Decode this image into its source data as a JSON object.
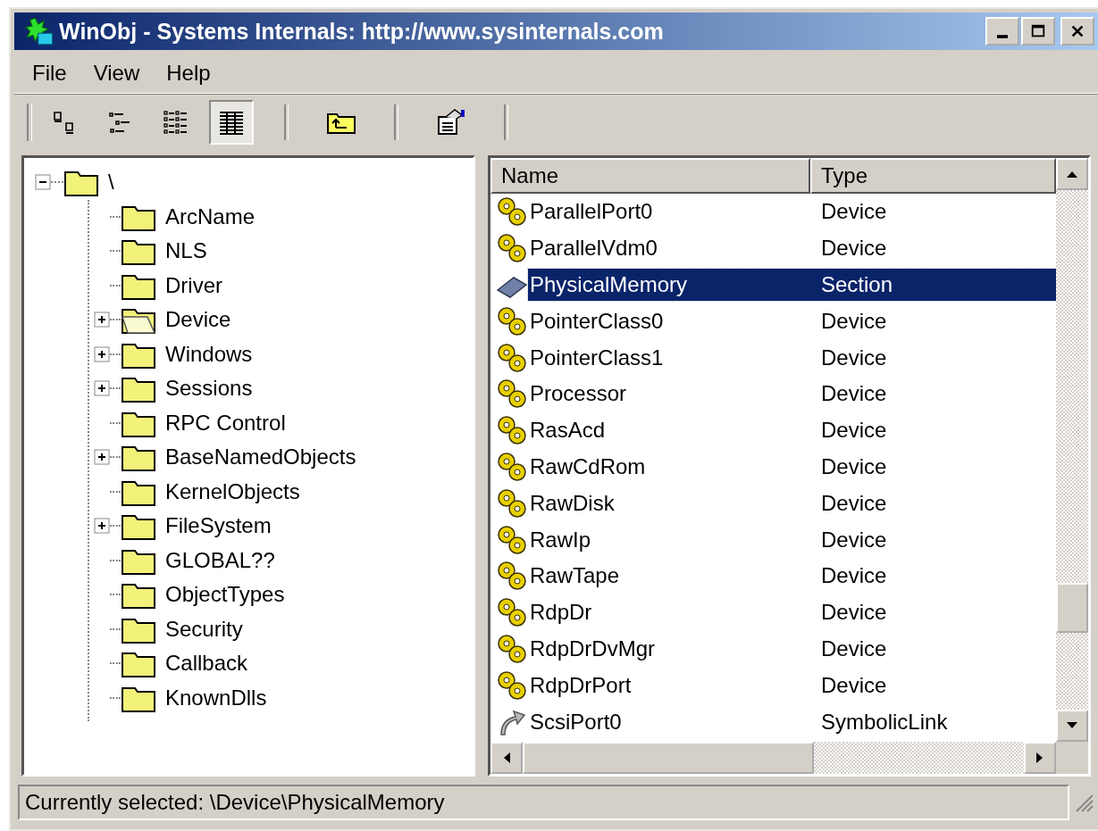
{
  "window": {
    "title": "WinObj - Systems Internals: http://www.sysinternals.com"
  },
  "menu": [
    {
      "label": "File"
    },
    {
      "label": "View"
    },
    {
      "label": "Help"
    }
  ],
  "toolbar": {
    "view_buttons": [
      {
        "kind": "large",
        "selected": false
      },
      {
        "kind": "small",
        "selected": false
      },
      {
        "kind": "list",
        "selected": false
      },
      {
        "kind": "details",
        "selected": true
      }
    ]
  },
  "tree": {
    "label": "\\",
    "expanded": true,
    "children": [
      {
        "label": "ArcName",
        "expander": false,
        "selected": false
      },
      {
        "label": "NLS",
        "expander": false,
        "selected": false
      },
      {
        "label": "Driver",
        "expander": false,
        "selected": false
      },
      {
        "label": "Device",
        "expander": true,
        "selected": true
      },
      {
        "label": "Windows",
        "expander": true,
        "selected": false
      },
      {
        "label": "Sessions",
        "expander": true,
        "selected": false
      },
      {
        "label": "RPC Control",
        "expander": false,
        "selected": false
      },
      {
        "label": "BaseNamedObjects",
        "expander": true,
        "selected": false
      },
      {
        "label": "KernelObjects",
        "expander": false,
        "selected": false
      },
      {
        "label": "FileSystem",
        "expander": true,
        "selected": false
      },
      {
        "label": "GLOBAL??",
        "expander": false,
        "selected": false
      },
      {
        "label": "ObjectTypes",
        "expander": false,
        "selected": false
      },
      {
        "label": "Security",
        "expander": false,
        "selected": false
      },
      {
        "label": "Callback",
        "expander": false,
        "selected": false
      },
      {
        "label": "KnownDlls",
        "expander": false,
        "selected": false
      }
    ]
  },
  "table": {
    "columns": [
      "Name",
      "Type"
    ],
    "rows": [
      {
        "name": "ParallelPort0",
        "type": "Device",
        "kind": "device",
        "selected": false
      },
      {
        "name": "ParallelVdm0",
        "type": "Device",
        "kind": "device",
        "selected": false
      },
      {
        "name": "PhysicalMemory",
        "type": "Section",
        "kind": "section",
        "selected": true
      },
      {
        "name": "PointerClass0",
        "type": "Device",
        "kind": "device",
        "selected": false
      },
      {
        "name": "PointerClass1",
        "type": "Device",
        "kind": "device",
        "selected": false
      },
      {
        "name": "Processor",
        "type": "Device",
        "kind": "device",
        "selected": false
      },
      {
        "name": "RasAcd",
        "type": "Device",
        "kind": "device",
        "selected": false
      },
      {
        "name": "RawCdRom",
        "type": "Device",
        "kind": "device",
        "selected": false
      },
      {
        "name": "RawDisk",
        "type": "Device",
        "kind": "device",
        "selected": false
      },
      {
        "name": "RawIp",
        "type": "Device",
        "kind": "device",
        "selected": false
      },
      {
        "name": "RawTape",
        "type": "Device",
        "kind": "device",
        "selected": false
      },
      {
        "name": "RdpDr",
        "type": "Device",
        "kind": "device",
        "selected": false
      },
      {
        "name": "RdpDrDvMgr",
        "type": "Device",
        "kind": "device",
        "selected": false
      },
      {
        "name": "RdpDrPort",
        "type": "Device",
        "kind": "device",
        "selected": false
      },
      {
        "name": "ScsiPort0",
        "type": "SymbolicLink",
        "kind": "symlink",
        "selected": false
      }
    ]
  },
  "status_bar": {
    "text": "Currently selected:  \\Device\\PhysicalMemory"
  }
}
